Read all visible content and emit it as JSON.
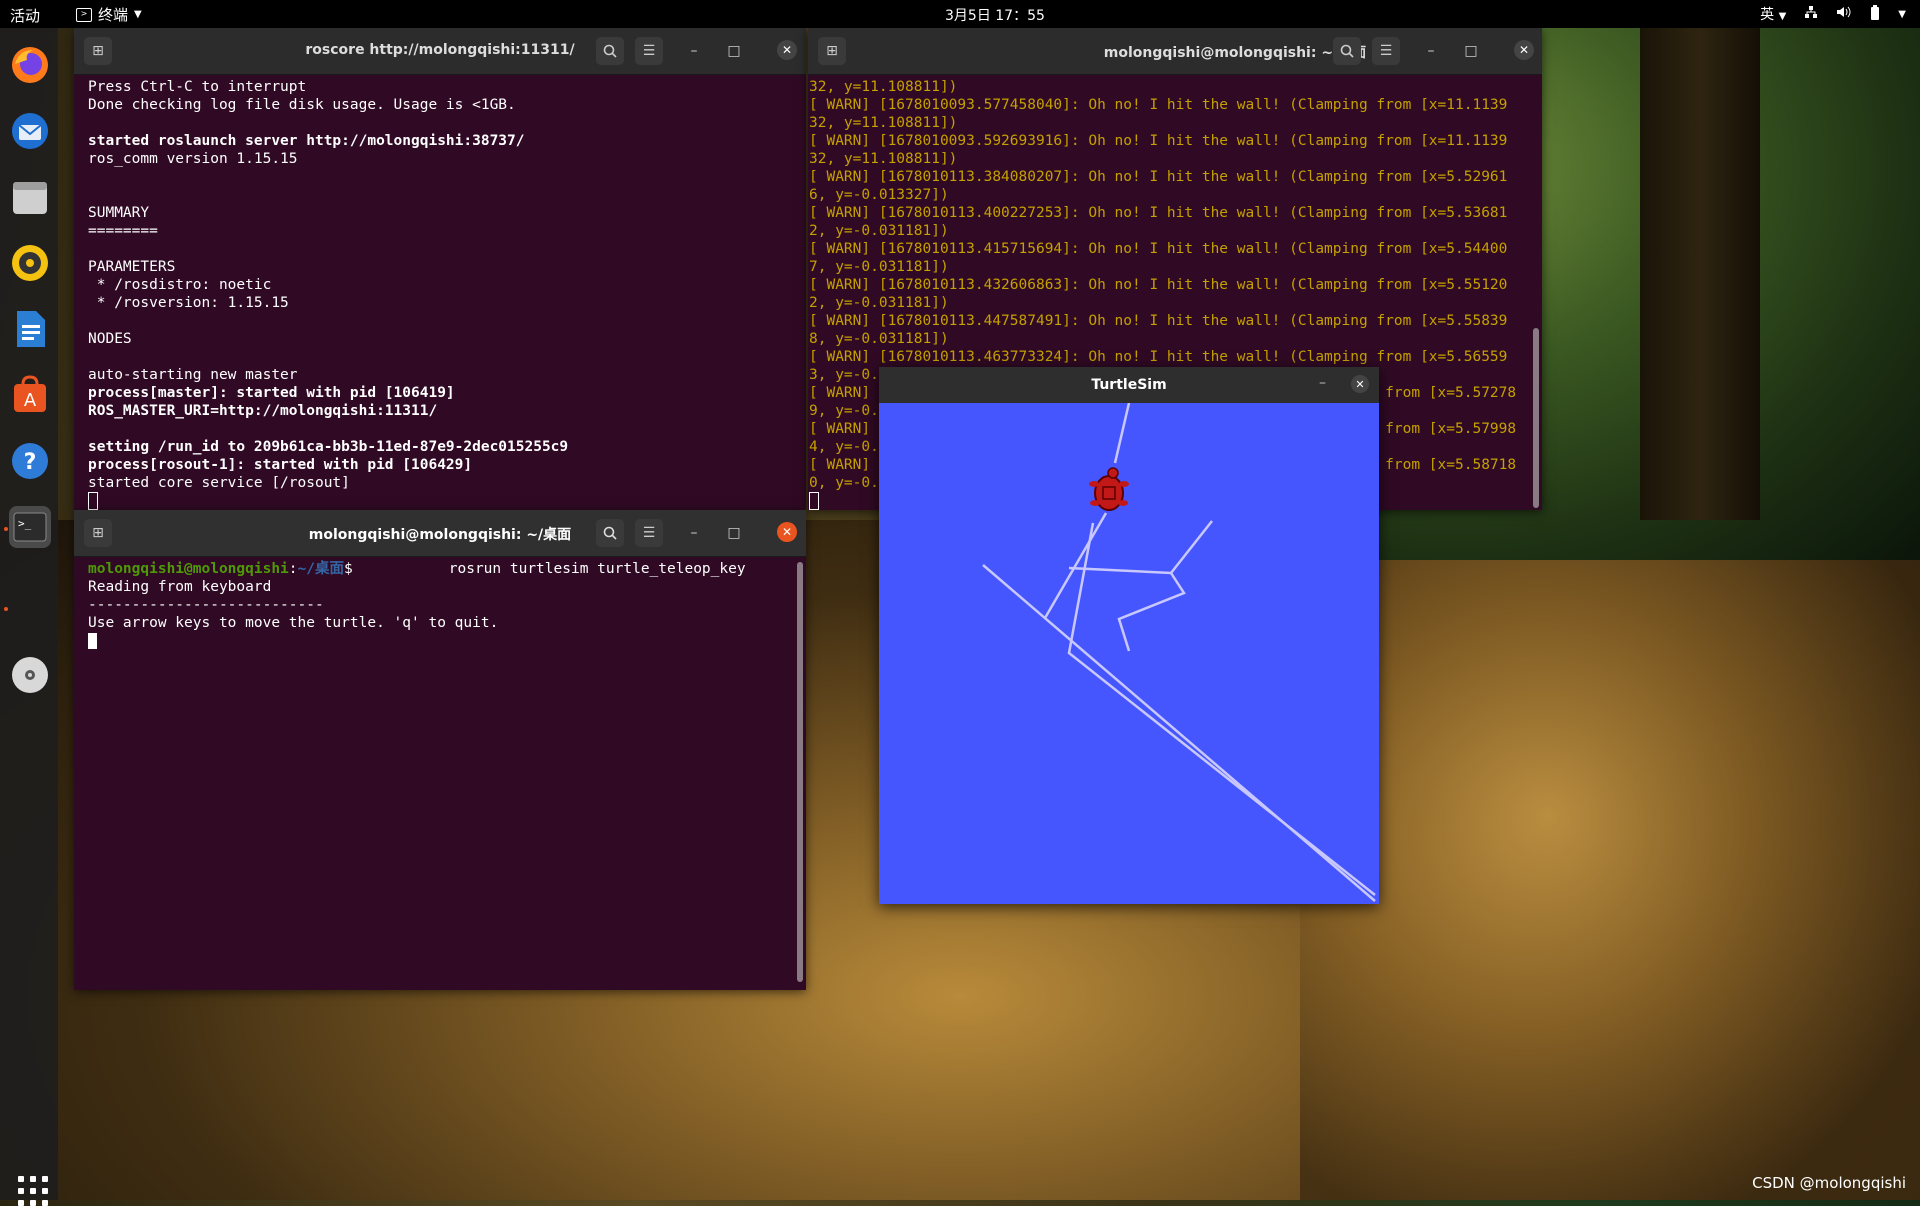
{
  "topbar": {
    "activities": "活动",
    "app_name": "终端",
    "clock": "3月5日  17：55",
    "input_method": "英"
  },
  "dock": {
    "items": [
      "firefox-icon",
      "thunderbird-icon",
      "files-icon",
      "rhythmbox-icon",
      "libreoffice-writer-icon",
      "software-icon",
      "help-icon",
      "terminal-icon",
      "dvd-icon"
    ]
  },
  "roscore_window": {
    "title": "roscore http://molongqishi:11311/",
    "lines": [
      {
        "text": "Press Ctrl-C to interrupt",
        "bold": false
      },
      {
        "text": "Done checking log file disk usage. Usage is <1GB.",
        "bold": false
      },
      {
        "text": "",
        "bold": false
      },
      {
        "text": "started roslaunch server http://molongqishi:38737/",
        "bold": true
      },
      {
        "text": "ros_comm version 1.15.15",
        "bold": false
      },
      {
        "text": "",
        "bold": false
      },
      {
        "text": "",
        "bold": false
      },
      {
        "text": "SUMMARY",
        "bold": false
      },
      {
        "text": "========",
        "bold": false
      },
      {
        "text": "",
        "bold": false
      },
      {
        "text": "PARAMETERS",
        "bold": false
      },
      {
        "text": " * /rosdistro: noetic",
        "bold": false
      },
      {
        "text": " * /rosversion: 1.15.15",
        "bold": false
      },
      {
        "text": "",
        "bold": false
      },
      {
        "text": "NODES",
        "bold": false
      },
      {
        "text": "",
        "bold": false
      },
      {
        "text": "auto-starting new master",
        "bold": false
      },
      {
        "text": "process[master]: started with pid [106419]",
        "bold": true
      },
      {
        "text": "ROS_MASTER_URI=http://molongqishi:11311/",
        "bold": true
      },
      {
        "text": "",
        "bold": false
      },
      {
        "text": "setting /run_id to 209b61ca-bb3b-11ed-87e9-2dec015255c9",
        "bold": true
      },
      {
        "text": "process[rosout-1]: started with pid [106429]",
        "bold": true
      },
      {
        "text": "started core service [/rosout]",
        "bold": false
      }
    ]
  },
  "warn_window": {
    "title": "molongqishi@molongqishi: ~/桌面",
    "lines": [
      "32, y=11.108811])",
      "[ WARN] [1678010093.577458040]: Oh no! I hit the wall! (Clamping from [x=11.1139",
      "32, y=11.108811])",
      "[ WARN] [1678010093.592693916]: Oh no! I hit the wall! (Clamping from [x=11.1139",
      "32, y=11.108811])",
      "[ WARN] [1678010113.384080207]: Oh no! I hit the wall! (Clamping from [x=5.52961",
      "6, y=-0.013327])",
      "[ WARN] [1678010113.400227253]: Oh no! I hit the wall! (Clamping from [x=5.53681",
      "2, y=-0.031181])",
      "[ WARN] [1678010113.415715694]: Oh no! I hit the wall! (Clamping from [x=5.54400",
      "7, y=-0.031181])",
      "[ WARN] [1678010113.432606863]: Oh no! I hit the wall! (Clamping from [x=5.55120",
      "2, y=-0.031181])",
      "[ WARN] [1678010113.447587491]: Oh no! I hit the wall! (Clamping from [x=5.55839",
      "8, y=-0.031181])",
      "[ WARN] [1678010113.463773324]: Oh no! I hit the wall! (Clamping from [x=5.56559",
      "3, y=-0.",
      "[ WARN]                                                         g from [x=5.57278",
      "9, y=-0.",
      "[ WARN]                                                         g from [x=5.57998",
      "4, y=-0.",
      "[ WARN]                                                         g from [x=5.58718",
      "0, y=-0."
    ]
  },
  "teleop_window": {
    "title": "molongqishi@molongqishi: ~/桌面",
    "prompt_user": "molongqishi@molongqishi",
    "prompt_sep": ":",
    "prompt_path": "~/桌面",
    "prompt_dollar": "$",
    "command": "           rosrun turtlesim turtle_teleop_key",
    "lines": [
      "Reading from keyboard",
      "---------------------------",
      "Use arrow keys to move the turtle. 'q' to quit."
    ]
  },
  "turtlesim_window": {
    "title": "TurtleSim"
  },
  "watermark": "CSDN @molongqishi",
  "colors": {
    "terminal_bg": "#300a24",
    "turtlesim_bg": "#4556ff",
    "warn_text": "#c4a000",
    "accent": "#e95420"
  }
}
